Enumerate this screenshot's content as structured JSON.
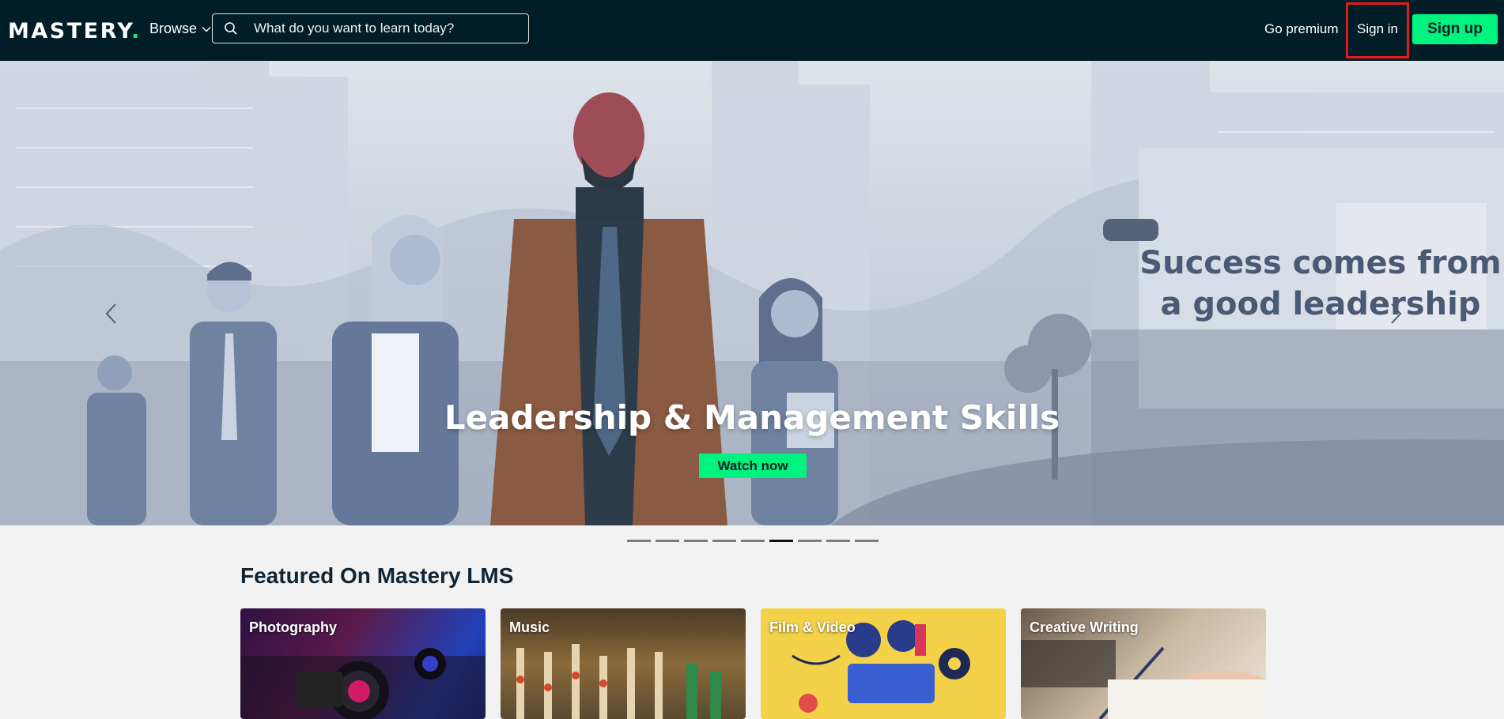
{
  "nav": {
    "logo_text": "MASTERY",
    "logo_dot": ".",
    "browse_label": "Browse",
    "search_placeholder": "What do you want to learn today?",
    "go_premium_label": "Go premium",
    "sign_in_label": "Sign in",
    "sign_up_label": "Sign up"
  },
  "hero": {
    "title": "Leadership & Management Skills",
    "cta_label": "Watch now",
    "tagline_line1": "Success comes from",
    "tagline_line2": "a good leadership",
    "slide_count": 9,
    "active_slide": 6
  },
  "featured": {
    "heading": "Featured On Mastery LMS",
    "cards": [
      {
        "label": "Photography"
      },
      {
        "label": "Music"
      },
      {
        "label": "Film & Video"
      },
      {
        "label": "Creative Writing"
      }
    ]
  },
  "colors": {
    "nav_bg": "#011d27",
    "accent_green": "#00f27f",
    "highlight_red": "#e01b1b",
    "page_bg": "#f2f2f2"
  }
}
